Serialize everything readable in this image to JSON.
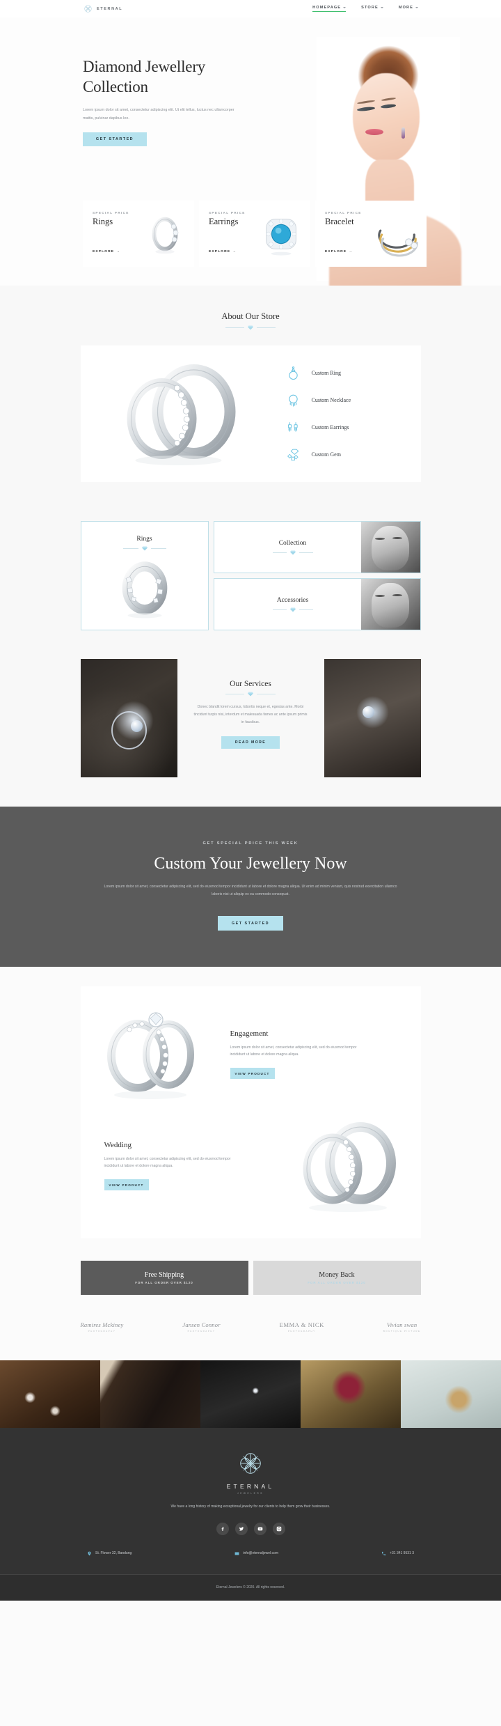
{
  "header": {
    "logo_text": "ETERNAL",
    "logo_icon": "eternal-flower-logo-icon",
    "nav": [
      {
        "label": "HOMEPAGE",
        "active": true
      },
      {
        "label": "STORE",
        "active": false
      },
      {
        "label": "MORE",
        "active": false
      }
    ]
  },
  "hero": {
    "title": "Diamond Jewellery Collection",
    "subtitle": "Lorem ipsum dolor sit amet, consectetur adipiscing elit. Ut elit tellus, luctus nec ullamcorper mattis, pulvinar dapibus leo.",
    "cta_label": "GET STARTED",
    "price_cards": [
      {
        "eyebrow": "SPECIAL PRICE",
        "name": "Rings",
        "link": "EXPLORE",
        "arrow": "→",
        "image": "silver-diamond-ring-image"
      },
      {
        "eyebrow": "SPECIAL PRICE",
        "name": "Earrings",
        "link": "EXPLORE",
        "arrow": "→",
        "image": "blue-topaz-halo-gem-image"
      },
      {
        "eyebrow": "SPECIAL PRICE",
        "name": "Bracelet",
        "link": "EXPLORE",
        "arrow": "→",
        "image": "gold-silver-bangle-image"
      }
    ]
  },
  "about": {
    "title": "About Our Store",
    "ring_image": "double-band-diamond-ring-image",
    "items": [
      {
        "label": "Custom Ring",
        "icon": "ring-outline-icon"
      },
      {
        "label": "Custom Necklace",
        "icon": "necklace-outline-icon"
      },
      {
        "label": "Custom Earrings",
        "icon": "earrings-outline-icon"
      },
      {
        "label": "Custom Gem",
        "icon": "gem-cluster-outline-icon"
      }
    ]
  },
  "categories": {
    "tall": {
      "name": "Rings",
      "image": "engraved-eternity-ring-image"
    },
    "wide": [
      {
        "name": "Collection",
        "image": "woman-with-rings-bw-photo"
      },
      {
        "name": "Accessories",
        "image": "woman-with-earrings-bw-photo"
      }
    ]
  },
  "services": {
    "title": "Our Services",
    "text": "Donec blandit lorem cursus, lobortis neque et, egestas ante. Morbi tincidunt turpis nisi, interdum et malesuada fames ac ante ipsum primis in faucibus.",
    "cta_label": "READ MORE",
    "left_image": "solitaire-ring-dark-stone-photo",
    "right_image": "solitaire-ring-on-rock-photo"
  },
  "cta": {
    "eyebrow": "GET SPECIAL PRICE THIS WEEK",
    "title": "Custom Your Jewellery Now",
    "text": "Lorem ipsum dolor sit amet, consectetur adipiscing elit, sed do eiusmod tempor incididunt ut labore et dolore magna aliqua. Ut enim ad minim veniam, quis nostrud exercitation ullamco laboris nisi ut aliquip ex ea commodo consequat.",
    "button_label": "GET STARTED"
  },
  "products": [
    {
      "title": "Engagement",
      "text": "Lorem ipsum dolor sit amet, consectetur adipiscing elit, sed do eiusmod tempor incididunt ut labore et dolore magna aliqua.",
      "button_label": "VIEW PRODUCT",
      "image": "engagement-bridal-ring-set-image"
    },
    {
      "title": "Wedding",
      "text": "Lorem ipsum dolor sit amet, consectetur adipiscing elit, sed do eiusmod tempor incididunt ut labore et dolore magna aliqua.",
      "button_label": "VIEW PRODUCT",
      "image": "wedding-double-band-rings-image"
    }
  ],
  "banners": [
    {
      "title": "Free Shipping",
      "subtitle": "FOR ALL ORDER OVER $120",
      "style": "dark"
    },
    {
      "title": "Money Back",
      "subtitle": "FOR ALL ORDER OVER $120",
      "style": "light"
    }
  ],
  "brands": [
    {
      "name": "Ramires Mckiney",
      "sub": "PHOTOGRAPHY"
    },
    {
      "name": "Jansen Connor",
      "sub": "PHOTOGRAPHY"
    },
    {
      "name": "EMMA & NICK",
      "sub": "PHOTOGRAPHY"
    },
    {
      "name": "Vivian swan",
      "sub": "BOUTIQUE PICTURE"
    }
  ],
  "gallery": [
    {
      "image": "diamonds-on-wood-photo"
    },
    {
      "image": "drop-earrings-in-box-photo"
    },
    {
      "image": "diamond-tennis-bracelet-photo"
    },
    {
      "image": "ruby-ring-closeup-photo"
    },
    {
      "image": "two-gold-bands-photo"
    }
  ],
  "footer": {
    "logo_icon": "eternal-flower-logo-icon",
    "brand": "ETERNAL",
    "brand_sub": "JEWELERS",
    "description": "We have a long history of making exceptional jewelry for our clients to help them grow their businesses.",
    "socials": [
      {
        "name": "facebook-icon"
      },
      {
        "name": "twitter-icon"
      },
      {
        "name": "youtube-icon"
      },
      {
        "name": "instagram-icon"
      }
    ],
    "contacts": [
      {
        "icon": "location-pin-icon",
        "text": "St. Flower 32, Bandung"
      },
      {
        "icon": "envelope-icon",
        "text": "info@eternaljewel.com"
      },
      {
        "icon": "phone-icon",
        "text": "+31 341 9531 3"
      }
    ],
    "copyright": "Eternal Jewelers © 2020. All rights reserved."
  },
  "colors": {
    "accent": "#b5e2ee",
    "accent_border": "#bfdfe8",
    "dark": "#5b5b5b",
    "footer": "#333333",
    "nav_active": "#3fbf6e"
  }
}
